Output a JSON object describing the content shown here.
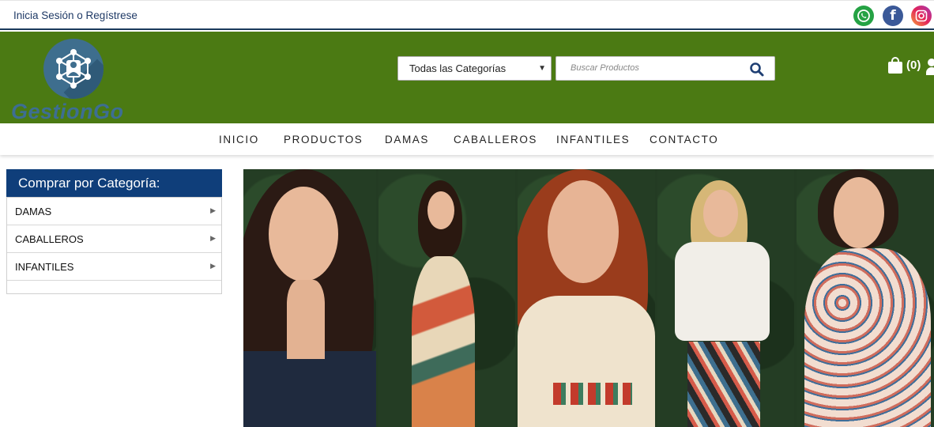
{
  "topbar": {
    "login_label": "Inicia Sesión o Regístrese",
    "social": [
      {
        "icon": "whatsapp-icon",
        "glyph": "✆",
        "color": "#25a244"
      },
      {
        "icon": "facebook-icon",
        "glyph": "f",
        "color": "#3b5998"
      },
      {
        "icon": "instagram-icon",
        "glyph": "◎",
        "color": "#c13584"
      }
    ]
  },
  "header": {
    "logo_text": "GestionGo",
    "category_select": {
      "selected": "Todas las Categorías"
    },
    "search": {
      "placeholder": "Buscar Productos"
    },
    "cart": {
      "count_label": "(0)"
    },
    "background_color": "#4b7a13"
  },
  "nav": {
    "items": [
      "INICIO",
      "PRODUCTOS",
      "DAMAS",
      "CABALLEROS",
      "INFANTILES",
      "CONTACTO"
    ]
  },
  "sidebar": {
    "title": "Comprar por Categoría:",
    "items": [
      "DAMAS",
      "CABALLEROS",
      "INFANTILES"
    ],
    "title_color": "#0f3e7a"
  }
}
